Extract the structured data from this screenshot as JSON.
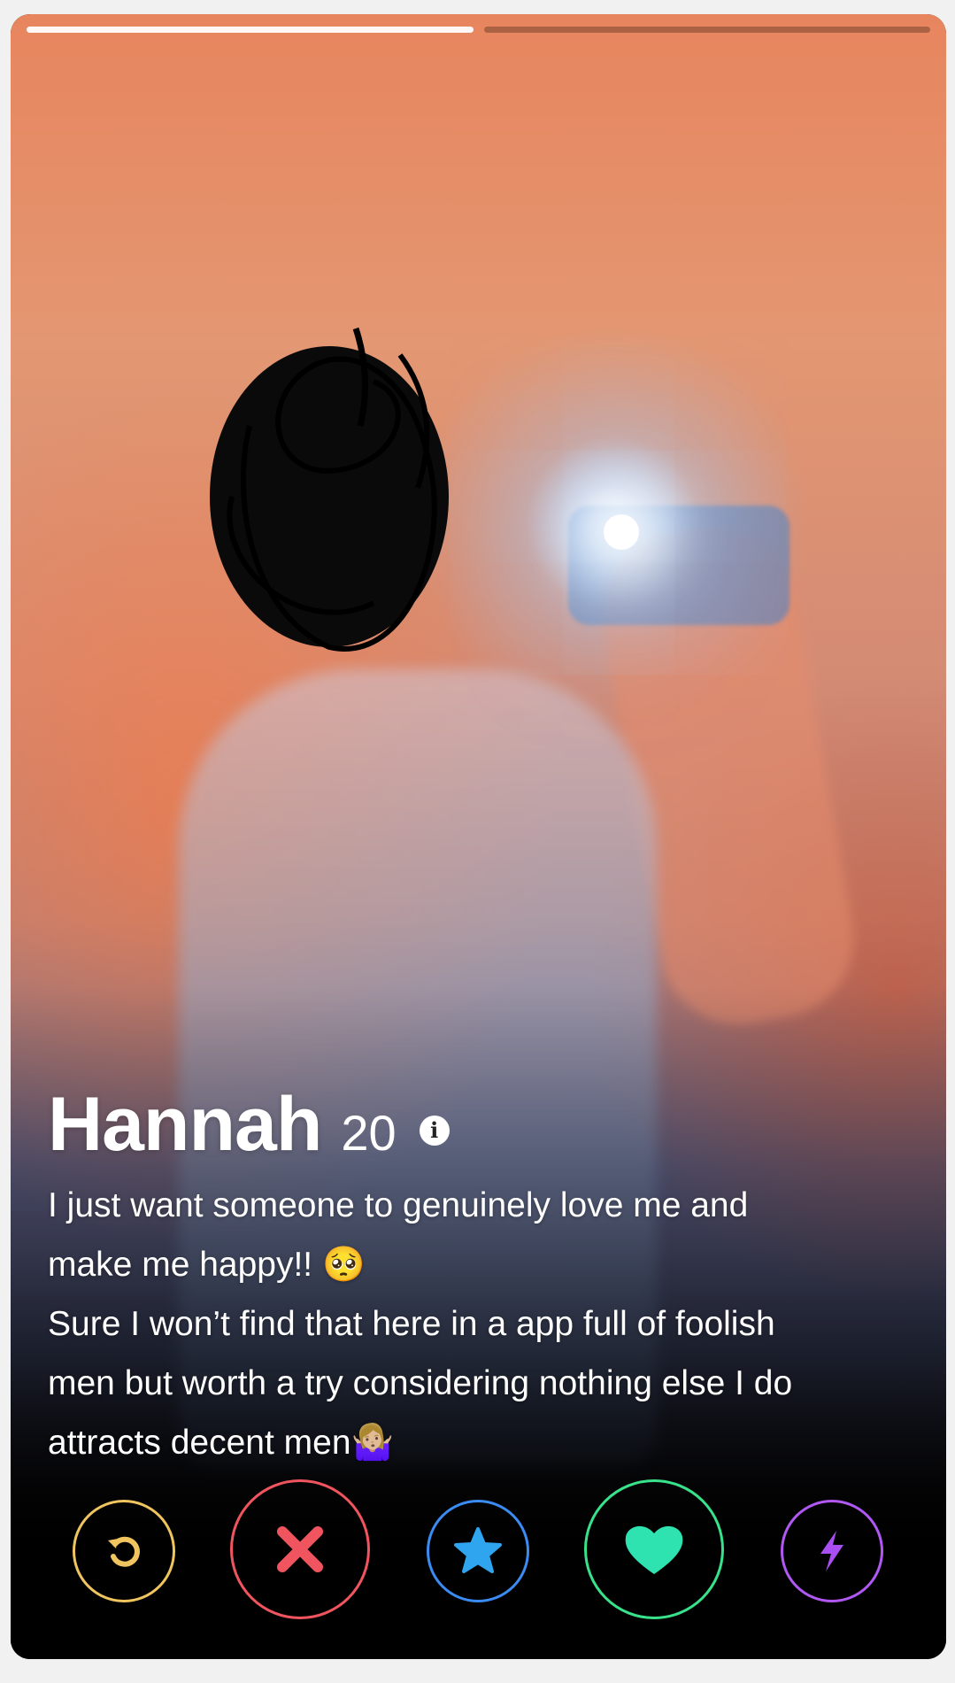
{
  "progress": {
    "total": 2,
    "active_index": 0
  },
  "profile": {
    "name": "Hannah",
    "age": "20",
    "info_icon": "i",
    "bio": "I just want someone to genuinely love me and\nmake me happy!! 🥺\nSure I won’t find that here in a app full of foolish\nmen but worth a try considering nothing else I do\nattracts decent men🤷🏼‍♀️"
  },
  "actions": [
    {
      "name": "rewind",
      "icon": "rewind-icon",
      "color": "#f0c55f"
    },
    {
      "name": "nope",
      "icon": "close-icon",
      "color": "#f0555f"
    },
    {
      "name": "super-like",
      "icon": "star-icon",
      "color": "#3a8bf2"
    },
    {
      "name": "like",
      "icon": "heart-icon",
      "color": "#38e28b"
    },
    {
      "name": "boost",
      "icon": "lightning-icon",
      "color": "#b158f3"
    }
  ]
}
